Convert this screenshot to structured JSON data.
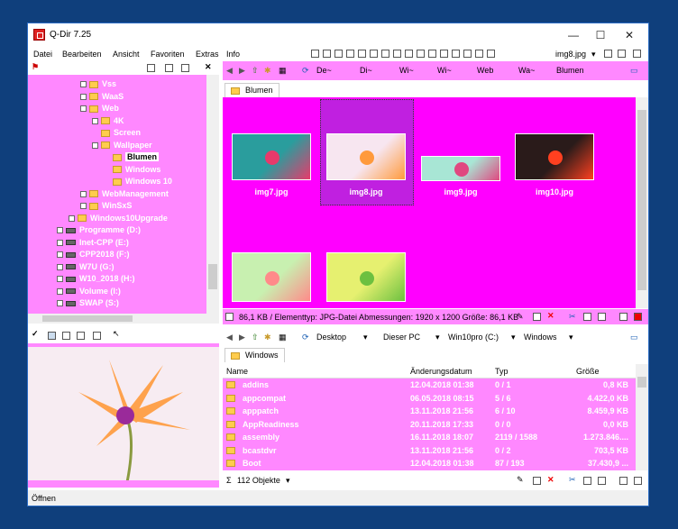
{
  "window": {
    "title": "Q-Dir 7.25",
    "minimize": "—",
    "maximize": "☐",
    "close": "✕"
  },
  "menu": [
    "Datei",
    "Bearbeiten",
    "Ansicht",
    "Favoriten",
    "Extras",
    "Info"
  ],
  "toolbar": {
    "current_file": "img8.jpg"
  },
  "address_top": [
    "De~",
    "Di~",
    "Wi~",
    "Wi~",
    "Web",
    "Wa~",
    "Blumen"
  ],
  "tree": [
    {
      "label": "Vss",
      "depth": 4,
      "type": "folder",
      "exp": "+"
    },
    {
      "label": "WaaS",
      "depth": 4,
      "type": "folder",
      "exp": "+"
    },
    {
      "label": "Web",
      "depth": 4,
      "type": "folder",
      "exp": "-"
    },
    {
      "label": "4K",
      "depth": 5,
      "type": "folder",
      "exp": "+"
    },
    {
      "label": "Screen",
      "depth": 5,
      "type": "folder",
      "exp": ""
    },
    {
      "label": "Wallpaper",
      "depth": 5,
      "type": "folder",
      "exp": "-"
    },
    {
      "label": "Blumen",
      "depth": 6,
      "type": "folder",
      "exp": "",
      "selected": true
    },
    {
      "label": "Windows",
      "depth": 6,
      "type": "folder",
      "exp": ""
    },
    {
      "label": "Windows 10",
      "depth": 6,
      "type": "folder",
      "exp": ""
    },
    {
      "label": "WebManagement",
      "depth": 4,
      "type": "folder",
      "exp": "+"
    },
    {
      "label": "WinSxS",
      "depth": 4,
      "type": "folder",
      "exp": "+"
    },
    {
      "label": "Windows10Upgrade",
      "depth": 3,
      "type": "folder",
      "exp": "+"
    },
    {
      "label": "Programme (D:)",
      "depth": 2,
      "type": "drive",
      "exp": "+"
    },
    {
      "label": "Inet-CPP (E:)",
      "depth": 2,
      "type": "drive",
      "exp": "+"
    },
    {
      "label": "CPP2018 (F:)",
      "depth": 2,
      "type": "drive",
      "exp": "+"
    },
    {
      "label": "W7U (G:)",
      "depth": 2,
      "type": "drive",
      "exp": "+"
    },
    {
      "label": "W10_2018 (H:)",
      "depth": 2,
      "type": "drive",
      "exp": "+"
    },
    {
      "label": "Volume (I:)",
      "depth": 2,
      "type": "drive",
      "exp": "+"
    },
    {
      "label": "SWAP (S:)",
      "depth": 2,
      "type": "drive",
      "exp": "+"
    }
  ],
  "top_tab": "Blumen",
  "images": [
    {
      "name": "img7.jpg",
      "colors": [
        "#2a9d9d",
        "#e83a6b"
      ]
    },
    {
      "name": "img8.jpg",
      "colors": [
        "#f7e6f0",
        "#ff9a3c"
      ],
      "selected": true
    },
    {
      "name": "img9.jpg",
      "colors": [
        "#a8e6d5",
        "#e04880"
      ]
    },
    {
      "name": "img10.jpg",
      "colors": [
        "#2a1b1a",
        "#ff4020"
      ]
    },
    {
      "name": "",
      "colors": [
        "#c8f0b0",
        "#ff8a8a"
      ]
    },
    {
      "name": "",
      "colors": [
        "#e6f070",
        "#6cc040"
      ]
    }
  ],
  "status_top": "86,1 KB / Elementtyp: JPG-Datei Abmessungen: 1920 x 1200 Größe: 86,1 KB",
  "address_bottom": [
    "Desktop",
    "Dieser PC",
    "Win10pro (C:)",
    "Windows"
  ],
  "bottom_tab": "Windows",
  "columns": [
    "Name",
    "Änderungsdatum",
    "Typ",
    "Größe"
  ],
  "rows": [
    [
      "addins",
      "12.04.2018 01:38",
      "0 / 1",
      "0,8 KB"
    ],
    [
      "appcompat",
      "06.05.2018 08:15",
      "5 / 6",
      "4.422,0 KB"
    ],
    [
      "apppatch",
      "13.11.2018 21:56",
      "6 / 10",
      "8.459,9 KB"
    ],
    [
      "AppReadiness",
      "20.11.2018 17:33",
      "0 / 0",
      "0,0 KB"
    ],
    [
      "assembly",
      "16.11.2018 18:07",
      "2119 / 1588",
      "1.273.846...."
    ],
    [
      "bcastdvr",
      "13.11.2018 21:56",
      "0 / 2",
      "703,5 KB"
    ],
    [
      "Boot",
      "12.04.2018 01:38",
      "87 / 193",
      "37.430,9 ..."
    ]
  ],
  "object_count": "112 Objekte",
  "statusbar": "Öffnen"
}
